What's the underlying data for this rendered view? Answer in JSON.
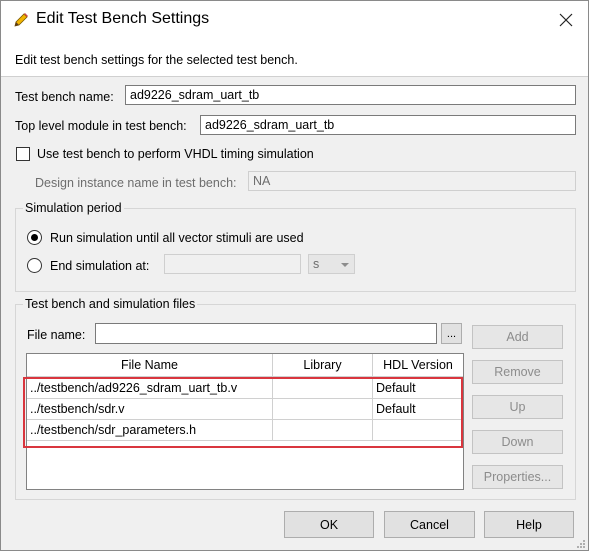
{
  "window": {
    "title": "Edit Test Bench Settings"
  },
  "description": "Edit test bench settings for the selected test bench.",
  "fields": {
    "test_bench_name_label": "Test bench name:",
    "test_bench_name_value": "ad9226_sdram_uart_tb",
    "top_level_label": "Top level module in test bench:",
    "top_level_value": "ad9226_sdram_uart_tb",
    "vhdl_checkbox_label": "Use test bench to perform VHDL timing simulation",
    "vhdl_checkbox_checked": false,
    "design_instance_label": "Design instance name in test bench:",
    "design_instance_value": "NA"
  },
  "simulation_period": {
    "title": "Simulation period",
    "run_option": "Run simulation until all vector stimuli are used",
    "end_option": "End simulation at:",
    "end_value": "",
    "unit": "s",
    "selected": "run"
  },
  "files": {
    "title": "Test bench and simulation files",
    "file_name_label": "File name:",
    "file_name_value": "",
    "browse_label": "...",
    "columns": [
      "File Name",
      "Library",
      "HDL Version"
    ],
    "rows": [
      {
        "file": "../testbench/ad9226_sdram_uart_tb.v",
        "library": "",
        "hdl": "Default"
      },
      {
        "file": "../testbench/sdr.v",
        "library": "",
        "hdl": "Default"
      },
      {
        "file": "../testbench/sdr_parameters.h",
        "library": "",
        "hdl": ""
      }
    ],
    "buttons": {
      "add": "Add",
      "remove": "Remove",
      "up": "Up",
      "down": "Down",
      "properties": "Properties..."
    }
  },
  "footer": {
    "ok": "OK",
    "cancel": "Cancel",
    "help": "Help"
  },
  "colors": {
    "highlight": "#d9363e",
    "background": "#f0f0f0"
  }
}
